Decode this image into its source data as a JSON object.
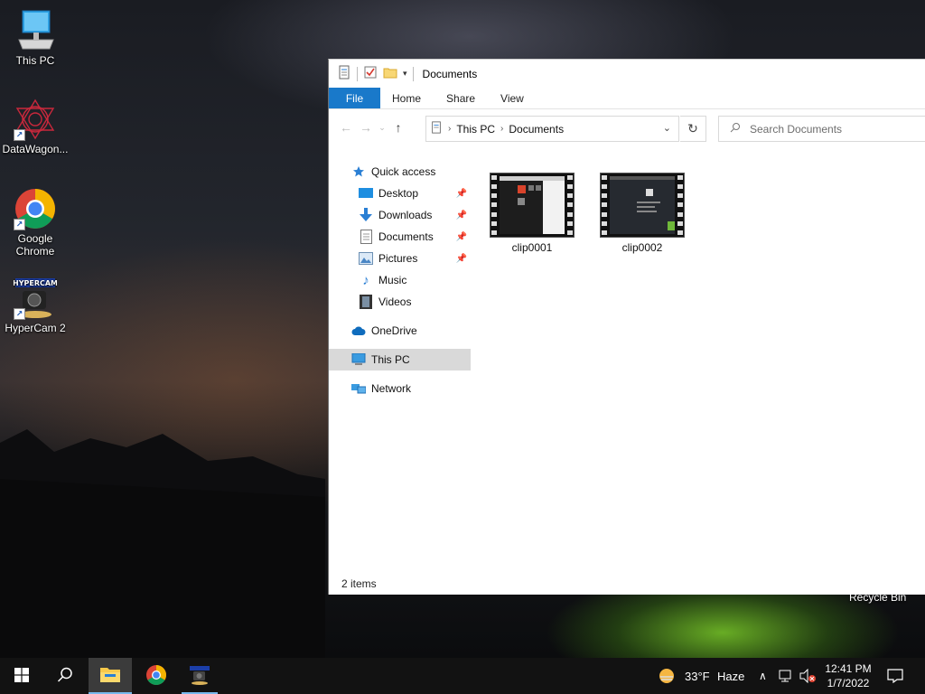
{
  "desktop": {
    "icons": [
      {
        "label": "This PC",
        "icon": "this-pc-icon"
      },
      {
        "label": "DataWagon...",
        "icon": "datawagon-icon"
      },
      {
        "label": "Google Chrome",
        "icon": "chrome-icon"
      },
      {
        "label": "HyperCam 2",
        "icon": "hypercam-icon"
      }
    ],
    "recycle_bin_label": "Recycle Bin"
  },
  "explorer": {
    "title": "Documents",
    "ribbon_tabs": [
      "File",
      "Home",
      "Share",
      "View"
    ],
    "breadcrumb": [
      "This PC",
      "Documents"
    ],
    "search_placeholder": "Search Documents",
    "nav": {
      "quick_access": "Quick access",
      "desktop": "Desktop",
      "downloads": "Downloads",
      "documents": "Documents",
      "pictures": "Pictures",
      "music": "Music",
      "videos": "Videos",
      "onedrive": "OneDrive",
      "this_pc": "This PC",
      "network": "Network"
    },
    "files": [
      {
        "name": "clip0001",
        "type": "video"
      },
      {
        "name": "clip0002",
        "type": "video"
      }
    ],
    "status": "2 items"
  },
  "taskbar": {
    "weather_temp": "33°F",
    "weather_desc": "Haze",
    "time": "12:41 PM",
    "date": "1/7/2022"
  },
  "colors": {
    "file_tab": "#1979ca",
    "selected_nav": "#d9d9d9",
    "taskbar": "#121212"
  }
}
